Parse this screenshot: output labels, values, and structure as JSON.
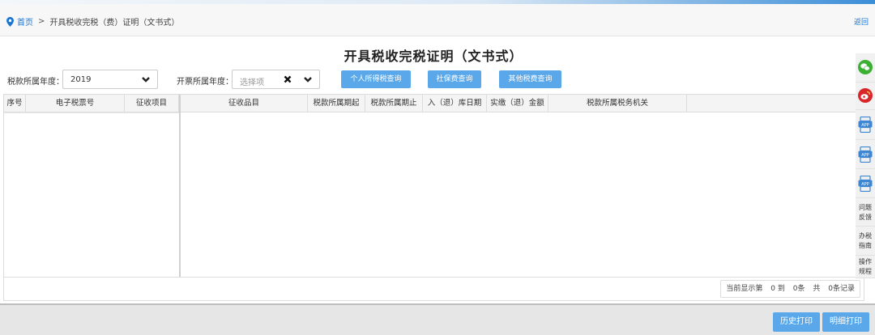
{
  "breadcrumb": {
    "home": "首页",
    "separator": ">",
    "current": "开具税收完税（费）证明（文书式）"
  },
  "header": {
    "back": "返回"
  },
  "page": {
    "title": "开具税收完税证明（文书式）"
  },
  "filters": {
    "tax_year_label": "税款所属年度：",
    "tax_year_value": "2019",
    "invoice_year_label": "开票所属年度：",
    "invoice_year_placeholder": "选择项"
  },
  "buttons": {
    "personal_income_tax": "个人所得税查询",
    "social_security": "社保费查询",
    "other_tax": "其他税费查询"
  },
  "table": {
    "frozen_columns": [
      "序号",
      "电子税票号",
      "征收项目"
    ],
    "columns": [
      "征收品目",
      "税款所属期起",
      "税款所属期止",
      "入（退）库日期",
      "实缴（退）金额",
      "税款所属税务机关"
    ],
    "rows": []
  },
  "pagination": {
    "prefix": "当前显示第",
    "from": "0 到",
    "to": "0条",
    "total_prefix": "共",
    "total": "0条记录"
  },
  "footer": {
    "history_print": "历史打印",
    "detail_print": "明细打印"
  },
  "side_rail": {
    "app1": "APP",
    "app2": "APP",
    "app3": "APP",
    "feedback": [
      "问题",
      "反馈"
    ],
    "guide": [
      "办税",
      "指南"
    ],
    "rules": [
      "操作",
      "规程"
    ]
  },
  "colors": {
    "accent": "#5aa8ea",
    "link": "#1a75d2",
    "wechat": "#3cb034",
    "weibo": "#d8262b"
  }
}
